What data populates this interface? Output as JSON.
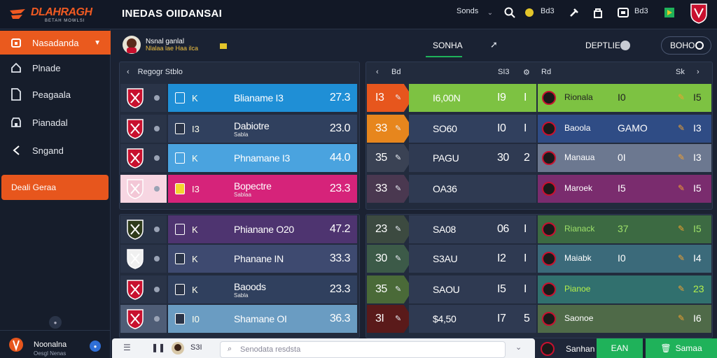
{
  "app": {
    "logo_text": "DLAHRAGH",
    "logo_sub": "BETAH MOWLSI",
    "title": "INEDAS OIIDANSAI"
  },
  "topbar": {
    "item1": "Sonds",
    "item2": "Bd3",
    "item3": "Bd3"
  },
  "sidebar": {
    "items": [
      {
        "label": "Nasadanda",
        "icon": "home-icon"
      },
      {
        "label": "Plnade",
        "icon": "house-icon"
      },
      {
        "label": "Peagaala",
        "icon": "file-icon"
      },
      {
        "label": "Pianadal",
        "icon": "store-icon"
      },
      {
        "label": "Sngand",
        "icon": "back-chevron-icon"
      }
    ],
    "action_label": "Deali Geraa",
    "footer_title": "Noonalna",
    "footer_sub": "Oesgl Nenas"
  },
  "subheader": {
    "user_line": "Nsnal ganlal",
    "user_sub": "Nlalaa lae Haa ilca",
    "tab_active": "SONHA",
    "right_label": "DEPTLIE",
    "pill_label": "BOHO"
  },
  "left_panel": {
    "header": "Regogr Stblo",
    "rows": [
      {
        "letter": "K",
        "label": "Blianame I3",
        "value": "27.3",
        "bar": "#1f8fd6"
      },
      {
        "letter": "I3",
        "label": "Dabiotre",
        "sub": "Sabla",
        "value": "23.0",
        "bar": "#30405e"
      },
      {
        "letter": "K",
        "label": "Phnamane I3",
        "value": "44.0",
        "bar": "#4aa3df"
      },
      {
        "letter": "I3",
        "label": "Bopectre",
        "sub": "Sablaa",
        "value": "23.3",
        "bar": "#d6237a"
      },
      {
        "letter": "K",
        "label": "Phianane O20",
        "value": "47.2",
        "bar": "#4e3470"
      },
      {
        "letter": "K",
        "label": "Phanane IN",
        "value": "33.3",
        "bar": "#3e4a70"
      },
      {
        "letter": "K",
        "label": "Baoods",
        "sub": "Sabla",
        "value": "23.3",
        "bar": "#30405e"
      },
      {
        "letter": "I0",
        "label": "Shamane OI",
        "value": "36.3",
        "bar": "#6a9cc2"
      }
    ]
  },
  "right_panel": {
    "header_a": "Bd",
    "header_b": "SI3",
    "header_c": "Rd",
    "header_d": "Sk",
    "rows": [
      {
        "rank": "I3",
        "code": "I6,00N",
        "a": "I9",
        "b": "I",
        "team": "Rionala",
        "n": "I0",
        "pts": "I5",
        "bar": "#7dc242"
      },
      {
        "rank": "33",
        "code": "SO60",
        "a": "I0",
        "b": "I",
        "team": "Baoola",
        "n": "GAMO",
        "pts": "I3",
        "bar": "#2f4c85"
      },
      {
        "rank": "35",
        "code": "PAGU",
        "a": "30",
        "b": "2",
        "team": "Manaua",
        "n": "0I",
        "pts": "I3",
        "bar": "#6c7890"
      },
      {
        "rank": "33",
        "code": "OA36",
        "a": "",
        "b": "",
        "team": "Maroek",
        "n": "I5",
        "pts": "I5",
        "bar": "#7a2c6e"
      },
      {
        "rank": "23",
        "code": "SA08",
        "a": "06",
        "b": "I",
        "team": "Rianack",
        "n": "37",
        "pts": "I5",
        "bar": "#3c6a42"
      },
      {
        "rank": "30",
        "code": "S3AU",
        "a": "I2",
        "b": "I",
        "team": "Maiabk",
        "n": "I0",
        "pts": "I4",
        "bar": "#3b6a7a"
      },
      {
        "rank": "35",
        "code": "SAOU",
        "a": "I5",
        "b": "I",
        "team": "Pianoe",
        "n": "",
        "pts": "23",
        "bar": "#31706e"
      },
      {
        "rank": "3I",
        "code": "$4,50",
        "a": "I7",
        "b": "5",
        "team": "Saonoe",
        "n": "",
        "pts": "I6",
        "bar": "#4f6a48"
      }
    ]
  },
  "bottom": {
    "label": "S3I",
    "search_placeholder": "Senodata resdsta",
    "btn1": "EAN",
    "btn2": "Samaa",
    "team": "Sanhan"
  },
  "colors": {
    "accent": "#ea5a1e",
    "green": "#1fb25a"
  }
}
